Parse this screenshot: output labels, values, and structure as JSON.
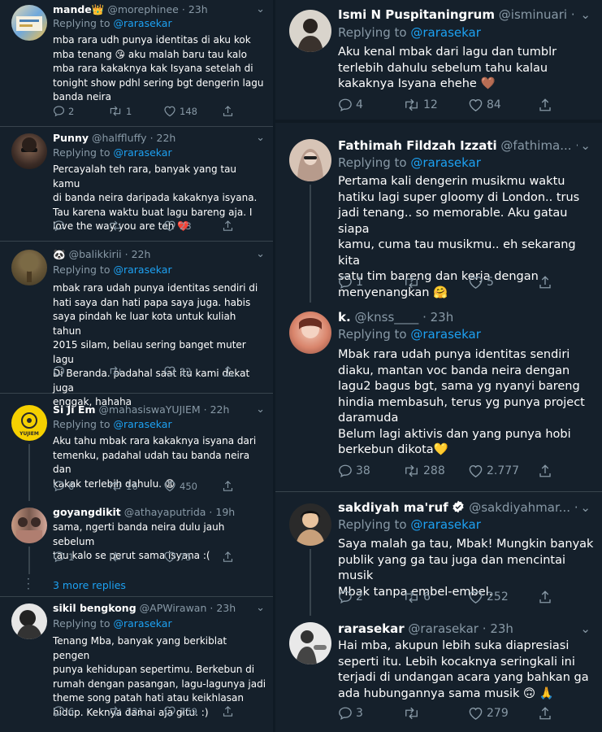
{
  "left": [
    {
      "name": "mande👑",
      "handle": "@morephinee",
      "time": "23h",
      "replying_prefix": "Replying to",
      "replying_to": "@rarasekar",
      "text": "mba rara udh punya identitas di aku kok\nmba tenang 😘 aku malah baru tau kalo\nmba rara kakaknya kak Isyana setelah di\ntonight show pdhl sering bgt dengerin lagu\nbanda neira",
      "replies": "2",
      "retweets": "1",
      "likes": "148"
    },
    {
      "name": "Punny",
      "handle": "@halffluffy",
      "time": "22h",
      "replying_prefix": "Replying to",
      "replying_to": "@rarasekar",
      "text": "Percayalah teh rara, banyak yang tau kamu\ndi banda neira daripada kakaknya isyana.\nTau karena waktu buat lagu bareng aja. I\nlove the way you are teh ❤️",
      "replies": "",
      "retweets": "",
      "likes": "23"
    },
    {
      "name": "🐼",
      "handle": "@balikkirii",
      "time": "22h",
      "replying_prefix": "Replying to",
      "replying_to": "@rarasekar",
      "text": "mbak rara udah punya identitas sendiri di\nhati saya dan hati papa saya juga. habis\nsaya pindah ke luar kota untuk kuliah tahun\n2015 silam, beliau sering banget muter lagu\nDi Beranda. padahal saat itu kami dekat juga\nenggak, hahaha",
      "replies": "",
      "retweets": "",
      "likes": "32"
    },
    {
      "name": "Si Ji Em",
      "handle": "@mahasiswaYUJIEM",
      "time": "22h",
      "replying_prefix": "Replying to",
      "replying_to": "@rarasekar",
      "text": "Aku tahu mbak rara kakaknya isyana dari\ntemenku, padahal udah tau banda neira dan\nkakak terlebih dahulu. 😩",
      "replies": "6",
      "retweets": "16",
      "likes": "450",
      "avatar_label": "YUJIEM"
    },
    {
      "name": "goyangdikit",
      "handle": "@athayaputrida",
      "time": "19h",
      "replying_prefix": "",
      "replying_to": "",
      "text": "sama, ngerti banda neira dulu jauh sebelum\ntau kalo se perut sama isyana :(",
      "replies": "1",
      "retweets": "",
      "likes": "75"
    },
    {
      "name": "sikil bengkong",
      "handle": "@APWirawan",
      "time": "23h",
      "replying_prefix": "Replying to",
      "replying_to": "@rarasekar",
      "text": "Tenang Mba, banyak yang berkiblat pengen\npunya kehidupan sepertimu. Berkebun di\nrumah dengan pasangan, lagu-lagunya jadi\ntheme song patah hati atau keikhlasan\nhidup. Keknya damai aja gitu. :)",
      "replies": "6",
      "retweets": "131",
      "likes": "759"
    }
  ],
  "more_replies": "3 more replies",
  "right": [
    {
      "name": "Ismi N Puspitaningrum",
      "handle": "@isminuari",
      "time": "23h",
      "replying_prefix": "Replying to",
      "replying_to": "@rarasekar",
      "text": "Aku kenal mbak dari lagu dan tumblr\nterlebih dahulu sebelum tahu kalau\nkakaknya Isyana ehehe 🤎",
      "replies": "4",
      "retweets": "12",
      "likes": "84"
    },
    {
      "name": "Fathimah Fildzah Izzati",
      "handle": "@fathima...",
      "time": "22h",
      "replying_prefix": "Replying to",
      "replying_to": "@rarasekar",
      "text": "Pertama kali dengerin musikmu waktu\nhatiku lagi super gloomy di London.. trus\njadi tenang.. so memorable. Aku gatau siapa\nkamu, cuma tau musikmu.. eh sekarang kita\nsatu tim bareng dan kerja dengan\nmenyenangkan 🤗",
      "replies": "1",
      "retweets": "",
      "likes": "5"
    },
    {
      "name": "k.",
      "handle": "@knss____",
      "time": "23h",
      "replying_prefix": "Replying to",
      "replying_to": "@rarasekar",
      "text": "Mbak rara udah punya identitas sendiri\ndiaku, mantan voc banda neira dengan\nlagu2 bagus bgt, sama yg nyanyi bareng\nhindia membasuh, terus yg punya project\ndaramuda\nBelum lagi aktivis dan yang punya hobi\nberkebun dikota💛",
      "replies": "38",
      "retweets": "288",
      "likes": "2.777"
    },
    {
      "name": "sakdiyah ma'ruf",
      "handle": "@sakdiyahmar...",
      "time": "23h",
      "replying_prefix": "Replying to",
      "replying_to": "@rarasekar",
      "text": "Saya malah ga tau, Mbak! Mungkin banyak\npublik yang ga tau juga dan mencintai musik\nMbak tanpa embel-embel.",
      "replies": "2",
      "retweets": "6",
      "likes": "252"
    },
    {
      "name": "rarasekar",
      "handle": "@rarasekar",
      "time": "23h",
      "replying_prefix": "",
      "replying_to": "",
      "text": "Hai mba, akupun lebih suka diapresiasi\nseperti itu. Lebih kocaknya seringkali ini\nterjadi di undangan acara yang bahkan ga\nada hubungannya sama musik 🙃 🙏",
      "replies": "3",
      "retweets": "",
      "likes": "279"
    }
  ],
  "colors": {
    "background": "#15202b",
    "link": "#1da1f2",
    "muted": "#8899a6",
    "border": "#38444d",
    "verified": "#ffffff"
  }
}
